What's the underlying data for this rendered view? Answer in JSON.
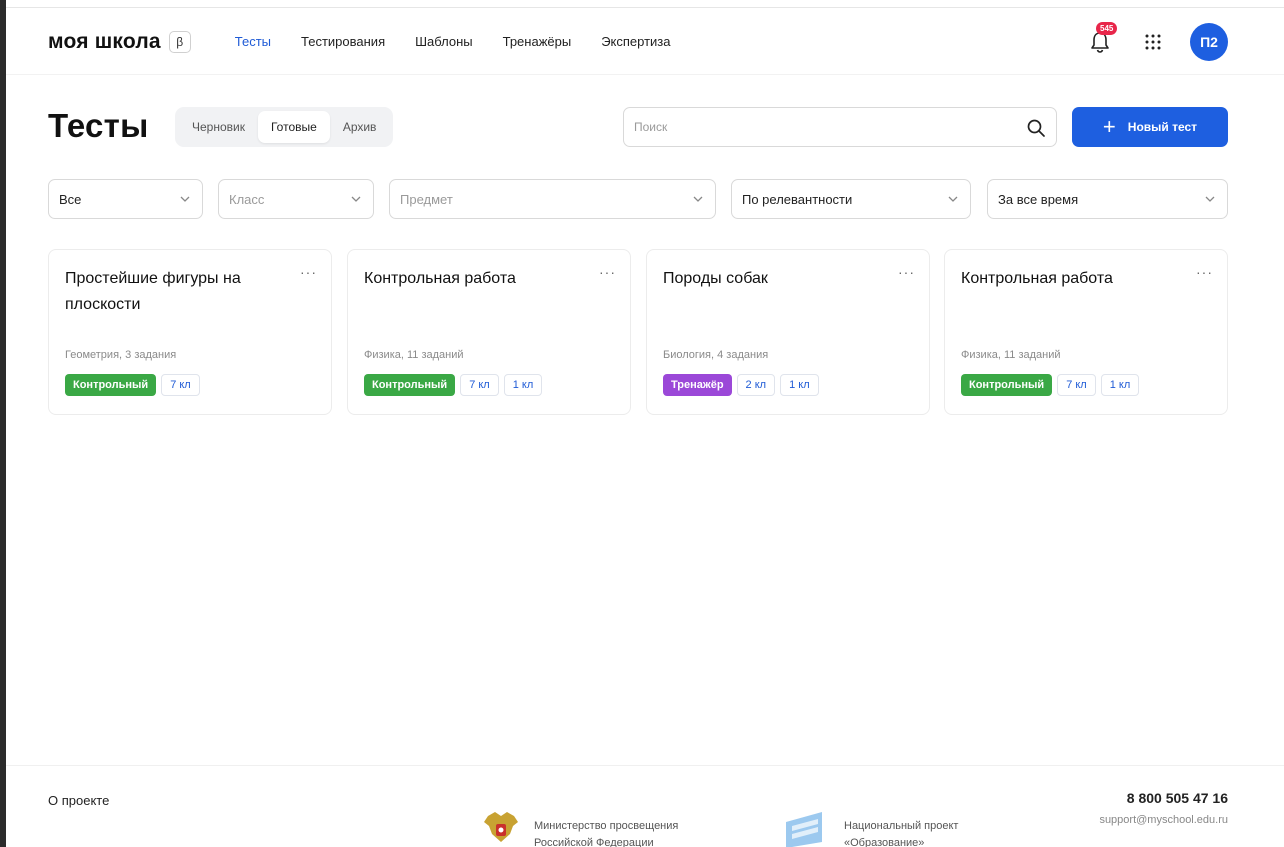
{
  "header": {
    "logo": "моя школа",
    "beta": "β",
    "nav": [
      {
        "label": "Тесты",
        "active": true
      },
      {
        "label": "Тестирования",
        "active": false
      },
      {
        "label": "Шаблоны",
        "active": false
      },
      {
        "label": "Тренажёры",
        "active": false
      },
      {
        "label": "Экспертиза",
        "active": false
      }
    ],
    "notifications_count": "545",
    "avatar": "П2",
    "icons": [
      "bell-icon",
      "apps-grid-icon"
    ]
  },
  "title_row": {
    "title": "Тесты",
    "tabs": [
      {
        "label": "Черновик",
        "active": false
      },
      {
        "label": "Готовые",
        "active": true
      },
      {
        "label": "Архив",
        "active": false
      }
    ],
    "search_placeholder": "Поиск",
    "new_button": "Новый тест"
  },
  "filters": [
    {
      "value": "Все",
      "placeholder": false
    },
    {
      "value": "Класс",
      "placeholder": true
    },
    {
      "value": "Предмет",
      "placeholder": true
    },
    {
      "value": "По релевантности",
      "placeholder": false
    },
    {
      "value": "За все время",
      "placeholder": false
    }
  ],
  "cards": [
    {
      "title": "Простейшие фигуры на плоскости",
      "meta": "Геометрия, 3 задания",
      "type": {
        "label": "Контрольный",
        "color": "green"
      },
      "grades": [
        "7 кл"
      ]
    },
    {
      "title": "Контрольная работа",
      "meta": "Физика, 11 заданий",
      "type": {
        "label": "Контрольный",
        "color": "green"
      },
      "grades": [
        "7 кл",
        "1 кл"
      ]
    },
    {
      "title": "Породы собак",
      "meta": "Биология, 4 задания",
      "type": {
        "label": "Тренажёр",
        "color": "purple"
      },
      "grades": [
        "2 кл",
        "1 кл"
      ]
    },
    {
      "title": "Контрольная работа",
      "meta": "Физика, 11 заданий",
      "type": {
        "label": "Контрольный",
        "color": "green"
      },
      "grades": [
        "7 кл",
        "1 кл"
      ]
    }
  ],
  "card_more": "···",
  "footer": {
    "about": "О проекте",
    "phone": "8 800 505 47 16",
    "email": "support@myschool.edu.ru",
    "ministry": [
      "Министерство просвещения",
      "Российской Федерации"
    ],
    "national_project": [
      "Национальный проект",
      "«Образование»"
    ]
  },
  "colors": {
    "accent": "#1e5fe0",
    "nav_active": "#1f5bd6",
    "tag_green": "#3aa845",
    "tag_purple": "#9b48d8",
    "badge_red": "#e8264a"
  }
}
